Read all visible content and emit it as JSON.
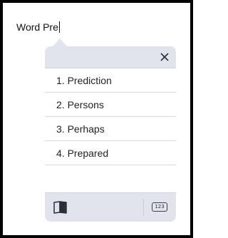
{
  "editor": {
    "text": "Word Pre"
  },
  "popup": {
    "suggestions": [
      {
        "label": "1. Prediction"
      },
      {
        "label": "2. Persons"
      },
      {
        "label": "3. Perhaps"
      },
      {
        "label": "4. Prepared"
      }
    ],
    "close_icon": "close-icon",
    "footer": {
      "book_icon": "book-icon",
      "numbers_label": "123"
    }
  },
  "colors": {
    "popup_bg": "#e1e4ec",
    "list_bg": "#ffffff",
    "frame_border": "#000000"
  }
}
